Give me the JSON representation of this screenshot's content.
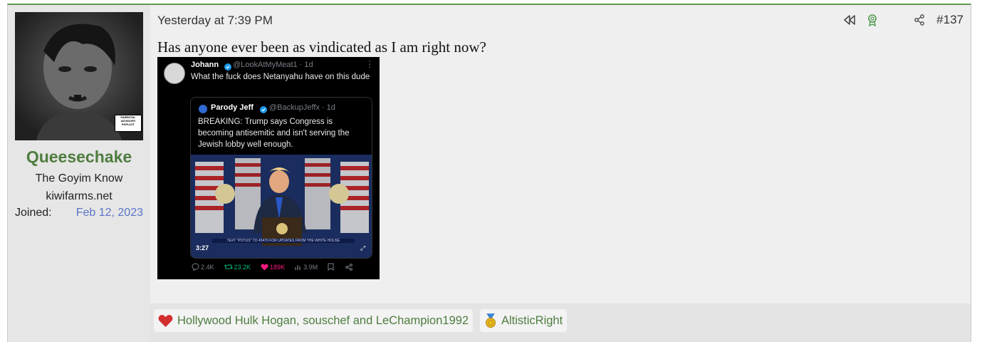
{
  "user": {
    "name": "Queesechake",
    "title": "The Goyim Know",
    "subtitle": "kiwifarms.net",
    "joined_label": "Joined:",
    "joined_date": "Feb 12, 2023",
    "avatar_sticker": "PARENTAL ADVISORY EXPLICIT CONTENT"
  },
  "post": {
    "date": "Yesterday at 7:39 PM",
    "number": "#137",
    "message": "Has anyone ever been as vindicated as I am right now?"
  },
  "embed": {
    "tweet": {
      "name": "Johann",
      "handle": "@LookAtMyMeat1 · 1d",
      "text": "What the fuck does Netanyahu have on this dude"
    },
    "quote": {
      "name": "Parody Jeff",
      "handle": "@BackupJeffx · 1d",
      "text": "BREAKING: Trump says Congress is becoming antisemitic and isn't serving the Jewish lobby well enough."
    },
    "video_duration": "3:27",
    "video_banner": "TEXT \"POTUS\" TO 45470 FOR UPDATES FROM THE WHITE HOUSE",
    "actions": {
      "replies": "2.4K",
      "retweets": "23.2K",
      "likes": "189K",
      "views": "3.9M"
    }
  },
  "reactions": [
    {
      "icon": "heart-icon",
      "text": "Hollywood Hulk Hogan, souschef and LeChampion1992"
    },
    {
      "icon": "medal-icon",
      "text": "AltisticRight"
    }
  ],
  "colors": {
    "accent_green": "#4f7d3f",
    "date_blue": "#5b74c9",
    "heart_red": "#d32f2f"
  }
}
